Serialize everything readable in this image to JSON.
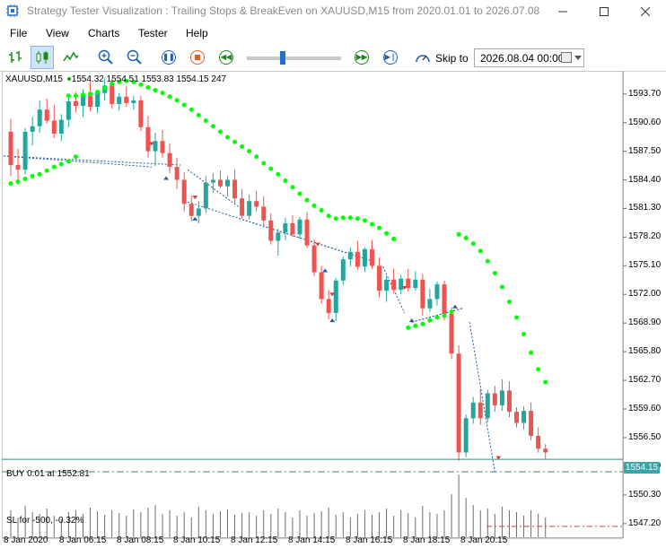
{
  "window": {
    "title": "Strategy Tester Visualization : Trailing Stops & BreakEven on XAUUSD,M15 from 2020.01.01 to 2026.07.08",
    "min_icon": "minimize-icon",
    "max_icon": "maximize-icon",
    "close_icon": "close-icon"
  },
  "menu": [
    "File",
    "View",
    "Charts",
    "Tester",
    "Help"
  ],
  "toolbar": {
    "skip_label": "Skip to",
    "skip_date": "2026.08.04 00:00"
  },
  "chart": {
    "symbol_info": "XAUUSD,M15",
    "ohlc": "1554.32 1554.51 1553.83 1554.15 247",
    "position_label": "BUY 0.01 at 1552.81",
    "sl_label": "SL for -500, -0.32%",
    "current_price": "1554.15",
    "price_labels": [
      "1593.70",
      "1590.60",
      "1587.50",
      "1584.40",
      "1581.30",
      "1578.20",
      "1575.10",
      "1572.00",
      "1568.90",
      "1565.80",
      "1562.70",
      "1559.60",
      "1556.50",
      "1553.40",
      "1550.30",
      "1547.20"
    ],
    "time_labels": [
      "8 Jan 2020",
      "8 Jan 06:15",
      "8 Jan 08:15",
      "8 Jan 10:15",
      "8 Jan 12:15",
      "8 Jan 14:15",
      "8 Jan 16:15",
      "8 Jan 18:15",
      "8 Jan 20:15"
    ],
    "colors": {
      "bull": "#26a69a",
      "bear": "#ef5350",
      "psar": "#00ff00",
      "line": "#1e5aa8",
      "grid": "#ffffff"
    }
  },
  "chart_data": {
    "type": "candlestick",
    "candles": [
      [
        1589.6,
        1591.0,
        1584.8,
        1586.0
      ],
      [
        1586.0,
        1587.8,
        1583.9,
        1585.5
      ],
      [
        1585.5,
        1590.0,
        1585.0,
        1589.6
      ],
      [
        1589.6,
        1591.2,
        1588.1,
        1590.2
      ],
      [
        1590.2,
        1593.0,
        1589.5,
        1592.0
      ],
      [
        1592.0,
        1593.2,
        1590.5,
        1590.8
      ],
      [
        1590.8,
        1592.5,
        1588.9,
        1589.4
      ],
      [
        1589.4,
        1591.5,
        1588.6,
        1590.9
      ],
      [
        1590.9,
        1593.6,
        1590.1,
        1592.9
      ],
      [
        1592.9,
        1593.9,
        1591.7,
        1592.4
      ],
      [
        1592.4,
        1594.2,
        1591.2,
        1593.5
      ],
      [
        1593.5,
        1595.0,
        1591.8,
        1592.3
      ],
      [
        1592.3,
        1594.1,
        1591.6,
        1593.8
      ],
      [
        1593.8,
        1595.4,
        1593.0,
        1594.6
      ],
      [
        1594.6,
        1595.3,
        1592.1,
        1592.6
      ],
      [
        1592.6,
        1593.8,
        1591.9,
        1593.4
      ],
      [
        1593.4,
        1594.5,
        1592.3,
        1592.7
      ],
      [
        1592.7,
        1593.5,
        1592.0,
        1593.0
      ],
      [
        1593.0,
        1593.5,
        1589.7,
        1590.1
      ],
      [
        1590.1,
        1591.3,
        1586.8,
        1587.5
      ],
      [
        1587.5,
        1589.5,
        1585.9,
        1588.6
      ],
      [
        1588.6,
        1589.8,
        1586.8,
        1587.3
      ],
      [
        1587.3,
        1588.3,
        1585.1,
        1585.8
      ],
      [
        1585.8,
        1586.8,
        1583.4,
        1584.4
      ],
      [
        1584.4,
        1585.2,
        1581.0,
        1581.8
      ],
      [
        1581.8,
        1582.7,
        1579.9,
        1580.5
      ],
      [
        1580.5,
        1582.1,
        1579.7,
        1581.3
      ],
      [
        1581.3,
        1584.8,
        1580.8,
        1584.1
      ],
      [
        1584.1,
        1585.1,
        1583.0,
        1584.4
      ],
      [
        1584.4,
        1585.4,
        1583.5,
        1583.7
      ],
      [
        1583.7,
        1584.8,
        1582.6,
        1584.4
      ],
      [
        1584.4,
        1585.5,
        1581.8,
        1582.4
      ],
      [
        1582.4,
        1583.4,
        1580.2,
        1580.5
      ],
      [
        1580.5,
        1582.8,
        1580.1,
        1582.1
      ],
      [
        1582.1,
        1583.2,
        1581.0,
        1581.5
      ],
      [
        1581.5,
        1582.6,
        1579.4,
        1580.0
      ],
      [
        1580.0,
        1580.8,
        1577.4,
        1577.8
      ],
      [
        1577.8,
        1579.1,
        1576.2,
        1578.7
      ],
      [
        1578.7,
        1580.3,
        1577.9,
        1579.7
      ],
      [
        1579.7,
        1580.6,
        1578.2,
        1578.5
      ],
      [
        1578.5,
        1580.4,
        1578.0,
        1580.1
      ],
      [
        1580.1,
        1580.9,
        1577.0,
        1577.3
      ],
      [
        1577.3,
        1577.9,
        1574.0,
        1574.4
      ],
      [
        1574.4,
        1575.1,
        1571.0,
        1571.5
      ],
      [
        1571.5,
        1572.5,
        1569.3,
        1570.0
      ],
      [
        1570.0,
        1573.8,
        1569.1,
        1573.5
      ],
      [
        1573.5,
        1576.1,
        1573.0,
        1575.8
      ],
      [
        1575.8,
        1577.1,
        1575.0,
        1576.6
      ],
      [
        1576.6,
        1577.8,
        1574.7,
        1575.0
      ],
      [
        1575.0,
        1577.1,
        1574.4,
        1576.9
      ],
      [
        1576.9,
        1577.9,
        1574.8,
        1575.1
      ],
      [
        1575.1,
        1576.0,
        1571.7,
        1572.4
      ],
      [
        1572.4,
        1574.0,
        1571.2,
        1573.6
      ],
      [
        1573.6,
        1574.8,
        1572.1,
        1572.5
      ],
      [
        1572.5,
        1574.1,
        1572.0,
        1573.7
      ],
      [
        1573.7,
        1574.8,
        1572.3,
        1572.7
      ],
      [
        1572.7,
        1574.5,
        1572.4,
        1573.6
      ],
      [
        1573.6,
        1574.2,
        1569.7,
        1570.5
      ],
      [
        1570.5,
        1572.6,
        1570.1,
        1571.5
      ],
      [
        1571.5,
        1573.4,
        1570.8,
        1573.1
      ],
      [
        1573.1,
        1573.5,
        1569.2,
        1569.9
      ],
      [
        1569.9,
        1570.6,
        1565.0,
        1565.6
      ],
      [
        1565.6,
        1566.5,
        1554.0,
        1554.9
      ],
      [
        1554.9,
        1559.0,
        1554.4,
        1558.6
      ],
      [
        1558.6,
        1560.9,
        1558.0,
        1560.3
      ],
      [
        1560.3,
        1561.8,
        1557.9,
        1558.6
      ],
      [
        1558.6,
        1561.7,
        1558.2,
        1561.3
      ],
      [
        1561.3,
        1562.1,
        1559.3,
        1560.0
      ],
      [
        1560.0,
        1562.8,
        1559.4,
        1561.6
      ],
      [
        1561.6,
        1562.6,
        1558.7,
        1559.3
      ],
      [
        1559.3,
        1559.8,
        1557.6,
        1558.1
      ],
      [
        1558.1,
        1559.9,
        1557.4,
        1559.4
      ],
      [
        1559.4,
        1560.3,
        1556.2,
        1556.7
      ],
      [
        1556.7,
        1557.6,
        1554.9,
        1555.3
      ],
      [
        1555.3,
        1555.8,
        1554.2,
        1554.9
      ]
    ],
    "psar": [
      [
        8,
        1593.5
      ],
      [
        9,
        1593.5
      ],
      [
        10,
        1593.6
      ],
      [
        11,
        1593.7
      ],
      [
        12,
        1593.9
      ],
      [
        13,
        1594.3
      ],
      [
        14,
        1594.8
      ],
      [
        15,
        1595.0
      ],
      [
        16,
        1595.1
      ],
      [
        17,
        1595.0
      ],
      [
        18,
        1594.7
      ],
      [
        19,
        1594.4
      ],
      [
        20,
        1594.1
      ],
      [
        21,
        1593.8
      ],
      [
        22,
        1593.4
      ],
      [
        23,
        1593.0
      ],
      [
        24,
        1592.5
      ],
      [
        25,
        1592.0
      ],
      [
        26,
        1591.4
      ],
      [
        27,
        1590.8
      ],
      [
        28,
        1590.2
      ],
      [
        29,
        1589.6
      ],
      [
        30,
        1589.0
      ],
      [
        31,
        1588.5
      ],
      [
        32,
        1588.0
      ],
      [
        33,
        1587.5
      ],
      [
        34,
        1586.9
      ],
      [
        35,
        1586.2
      ],
      [
        36,
        1585.6
      ],
      [
        37,
        1585.0
      ],
      [
        38,
        1584.3
      ],
      [
        39,
        1583.6
      ],
      [
        40,
        1582.9
      ],
      [
        41,
        1582.2
      ],
      [
        42,
        1581.6
      ],
      [
        43,
        1581.1
      ],
      [
        44,
        1580.5
      ],
      [
        45,
        1580.2
      ],
      [
        46,
        1580.3
      ],
      [
        47,
        1580.3
      ],
      [
        48,
        1580.2
      ],
      [
        49,
        1580.0
      ],
      [
        50,
        1579.6
      ],
      [
        51,
        1579.2
      ],
      [
        52,
        1578.6
      ],
      [
        53,
        1578.0
      ],
      [
        0,
        1584.0
      ],
      [
        1,
        1584.2
      ],
      [
        2,
        1584.5
      ],
      [
        3,
        1584.8
      ],
      [
        4,
        1585.0
      ],
      [
        5,
        1585.4
      ],
      [
        6,
        1585.8
      ],
      [
        7,
        1586.1
      ],
      [
        8,
        1586.4
      ],
      [
        9,
        1586.9
      ],
      [
        55,
        1568.4
      ],
      [
        56,
        1568.6
      ],
      [
        57,
        1568.8
      ],
      [
        58,
        1569.2
      ],
      [
        59,
        1569.5
      ],
      [
        60,
        1569.7
      ],
      [
        61,
        1570.1
      ],
      [
        62,
        1578.5
      ],
      [
        63,
        1578.1
      ],
      [
        64,
        1577.5
      ],
      [
        65,
        1576.7
      ],
      [
        66,
        1575.6
      ],
      [
        67,
        1574.3
      ],
      [
        68,
        1572.8
      ],
      [
        69,
        1571.2
      ],
      [
        70,
        1569.5
      ],
      [
        71,
        1567.7
      ],
      [
        72,
        1565.7
      ],
      [
        73,
        1563.9
      ],
      [
        74,
        1562.5
      ]
    ],
    "trades": [
      {
        "x": -1.5,
        "y": 1587.0
      },
      {
        "x": 23.5,
        "y": 1586.0
      },
      {
        "x": 24.5,
        "y": 1585.5
      },
      {
        "x": 31.5,
        "y": 1581.5
      },
      {
        "x": 32.5,
        "y": 1580.0
      },
      {
        "x": 50.5,
        "y": 1575.5
      },
      {
        "x": 51.5,
        "y": 1575.0
      },
      {
        "x": 54.5,
        "y": 1570.0
      },
      {
        "x": 55.5,
        "y": 1569.0
      },
      {
        "x": 62.5,
        "y": 1570.5
      },
      {
        "x": 63.5,
        "y": 1569.0
      },
      {
        "x": 67,
        "y": 1552.8
      }
    ],
    "volumes": [
      30,
      22,
      35,
      28,
      26,
      32,
      24,
      20,
      28,
      30,
      26,
      33,
      29,
      25,
      30,
      27,
      24,
      31,
      28,
      33,
      36,
      26,
      30,
      24,
      28,
      22,
      34,
      30,
      26,
      29,
      31,
      25,
      27,
      28,
      24,
      30,
      26,
      32,
      28,
      22,
      30,
      24,
      27,
      29,
      33,
      25,
      28,
      22,
      26,
      30,
      25,
      28,
      32,
      24,
      30,
      27,
      22,
      35,
      28,
      26,
      30,
      48,
      70,
      44,
      36,
      30,
      32,
      26,
      34,
      30,
      28,
      24,
      30,
      26,
      22
    ],
    "position_price": 1552.81,
    "sl_price": 1546.9,
    "ylim": [
      1546.5,
      1596.0
    ]
  }
}
